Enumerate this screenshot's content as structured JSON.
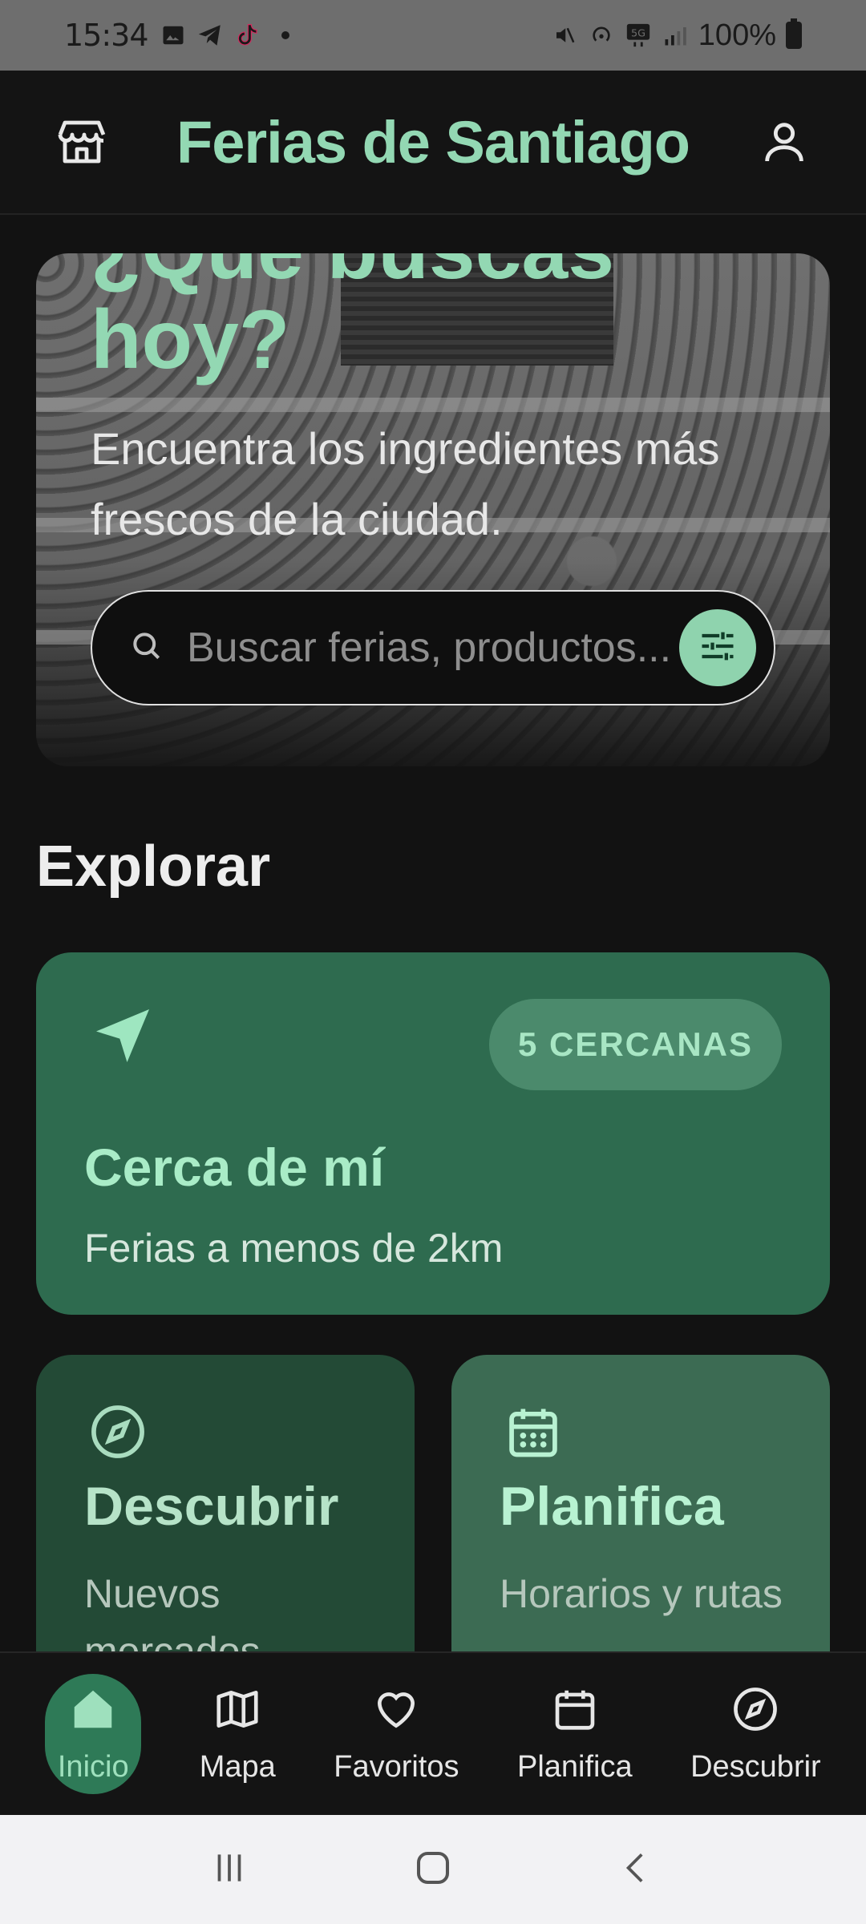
{
  "status_bar": {
    "time": "15:34",
    "battery": "100%",
    "network": "5G"
  },
  "header": {
    "title": "Ferias de Santiago"
  },
  "hero": {
    "title": "¿Qué buscas hoy?",
    "subtitle": "Encuentra los ingredientes más frescos de la ciudad.",
    "search_placeholder": "Buscar ferias, productos..."
  },
  "explore": {
    "title": "Explorar",
    "near": {
      "badge": "5 CERCANAS",
      "title": "Cerca de mí",
      "subtitle": "Ferias a menos de 2km"
    },
    "discover": {
      "title": "Descubrir",
      "subtitle": "Nuevos mercados"
    },
    "plan": {
      "title": "Planifica",
      "subtitle": "Horarios y rutas"
    }
  },
  "bottom_nav": {
    "items": [
      {
        "label": "Inicio",
        "icon": "home-icon"
      },
      {
        "label": "Mapa",
        "icon": "map-icon"
      },
      {
        "label": "Favoritos",
        "icon": "heart-icon"
      },
      {
        "label": "Planifica",
        "icon": "calendar-icon"
      },
      {
        "label": "Descubrir",
        "icon": "compass-icon"
      }
    ],
    "active": "Inicio"
  },
  "colors": {
    "accent": "#93d8b3",
    "card_near": "#2e6b4f",
    "card_discover": "#234a36",
    "card_plan": "#3c6b53",
    "background": "#121212"
  }
}
